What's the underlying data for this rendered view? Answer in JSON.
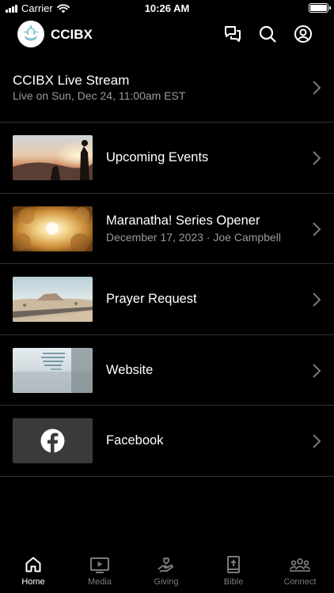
{
  "status_bar": {
    "carrier": "Carrier",
    "time": "10:26 AM"
  },
  "app": {
    "brand": "CCIBX"
  },
  "top_icons": [
    "chat-icon",
    "search-icon",
    "profile-icon"
  ],
  "live": {
    "title": "CCIBX Live Stream",
    "subtitle": "Live on Sun, Dec 24, 11:00am EST"
  },
  "items": [
    {
      "title": "Upcoming Events",
      "subtitle": "",
      "thumb": "sunset-people-thumbnail"
    },
    {
      "title": "Maranatha! Series Opener",
      "subtitle": "December 17, 2023 · Joe Campbell",
      "thumb": "clouds-light-thumbnail"
    },
    {
      "title": "Prayer Request",
      "subtitle": "",
      "thumb": "desert-road-thumbnail"
    },
    {
      "title": "Website",
      "subtitle": "",
      "thumb": "lake-quote-thumbnail"
    },
    {
      "title": "Facebook",
      "subtitle": "",
      "thumb": "facebook-logo-thumbnail"
    }
  ],
  "tabs": [
    {
      "label": "Home",
      "active": true
    },
    {
      "label": "Media",
      "active": false
    },
    {
      "label": "Giving",
      "active": false
    },
    {
      "label": "Bible",
      "active": false
    },
    {
      "label": "Connect",
      "active": false
    }
  ],
  "colors": {
    "background": "#000000",
    "text": "#ffffff",
    "secondary_text": "#9a9a9a",
    "divider": "#333333",
    "inactive_tab": "#7a7a7a"
  }
}
